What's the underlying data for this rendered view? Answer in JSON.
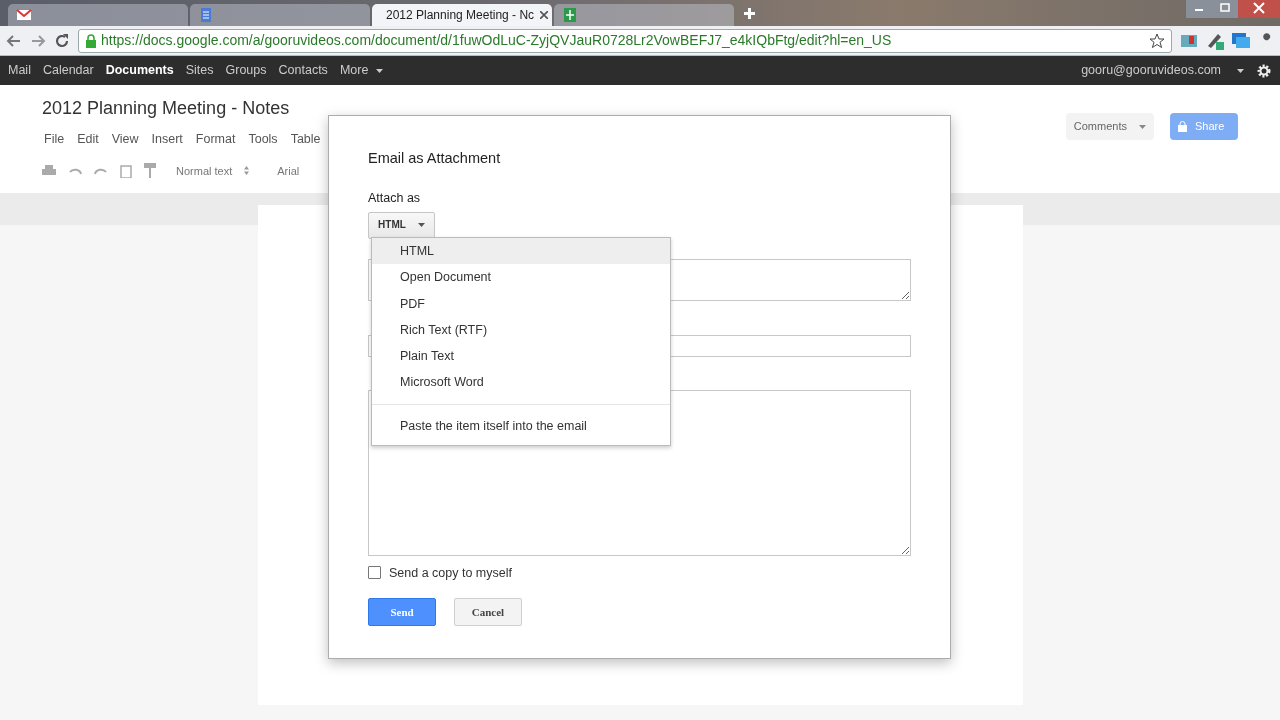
{
  "browser": {
    "tabs": [
      {
        "kind": "mail",
        "selected": false
      },
      {
        "kind": "doc",
        "selected": false
      },
      {
        "kind": "doc",
        "label": "2012 Planning Meeting - Nc",
        "selected": true
      },
      {
        "kind": "sheet",
        "selected": false
      }
    ],
    "url": "https://docs.google.com/a/gooruvideos.com/document/d/1fuwOdLuC-ZyjQVJauR0728Lr2VowBEFJ7_e4kIQbFtg/edit?hl=en_US"
  },
  "google_bar": {
    "items": [
      {
        "label": "Mail",
        "selected": false
      },
      {
        "label": "Calendar",
        "selected": false
      },
      {
        "label": "Documents",
        "selected": true
      },
      {
        "label": "Sites",
        "selected": false
      },
      {
        "label": "Groups",
        "selected": false
      },
      {
        "label": "Contacts",
        "selected": false
      },
      {
        "label": "More",
        "selected": false
      }
    ],
    "account": "gooru@gooruvideos.com"
  },
  "document": {
    "title": "2012 Planning Meeting - Notes",
    "menu": [
      "File",
      "Edit",
      "View",
      "Insert",
      "Format",
      "Tools",
      "Table"
    ],
    "style": "Normal text",
    "font": "Arial",
    "comments": "Comments",
    "share": "Share"
  },
  "dialog": {
    "title": "Email as Attachment",
    "attach_label": "Attach as",
    "attach_value": "HTML",
    "options": [
      {
        "label": "HTML",
        "selected": true
      },
      {
        "label": "Open Document",
        "selected": false
      },
      {
        "label": "PDF",
        "selected": false
      },
      {
        "label": "Rich Text (RTF)",
        "selected": false
      },
      {
        "label": "Plain Text",
        "selected": false
      },
      {
        "label": "Microsoft Word",
        "selected": false
      },
      {
        "label": "Paste the item itself into the email",
        "selected": false,
        "kind": "separated"
      }
    ],
    "send_copy": {
      "label": "Send a copy to myself",
      "checked": false
    },
    "buttons": [
      {
        "label": "Send",
        "kind": "primary"
      },
      {
        "label": "Cancel",
        "kind": "secondary"
      }
    ]
  }
}
